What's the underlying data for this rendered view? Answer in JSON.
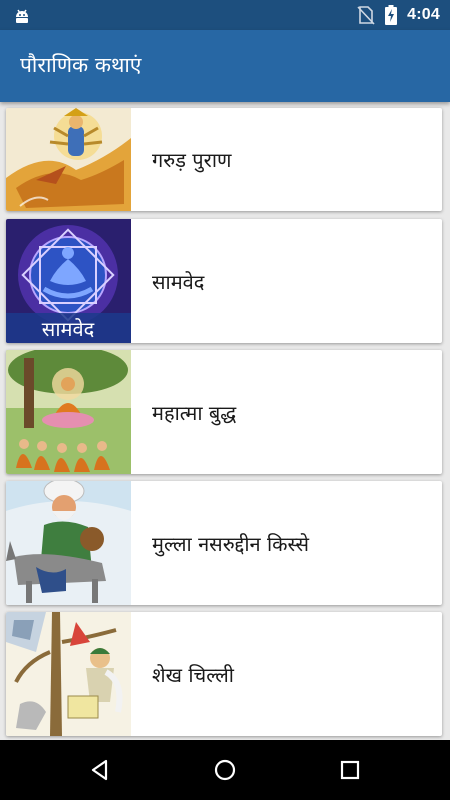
{
  "status_bar": {
    "time": "4:04",
    "icons": [
      "android-debug-icon",
      "no-sim-icon",
      "battery-charging-icon"
    ]
  },
  "app_bar": {
    "title": "पौराणिक कथाएं"
  },
  "stories": [
    {
      "label": "गरुड़ पुराण",
      "icon": "garuda-thumbnail"
    },
    {
      "label": "सामवेद",
      "icon": "samaveda-thumbnail",
      "image_text": "सामवेद"
    },
    {
      "label": "महात्मा बुद्ध",
      "icon": "buddha-thumbnail"
    },
    {
      "label": "मुल्ला नसरुद्दीन किस्से",
      "icon": "mulla-nasruddin-thumbnail"
    },
    {
      "label": "शेख चिल्ली",
      "icon": "shekh-chilli-thumbnail"
    }
  ],
  "nav_bar": {
    "icons": [
      "back-icon",
      "home-icon",
      "recents-icon"
    ]
  }
}
